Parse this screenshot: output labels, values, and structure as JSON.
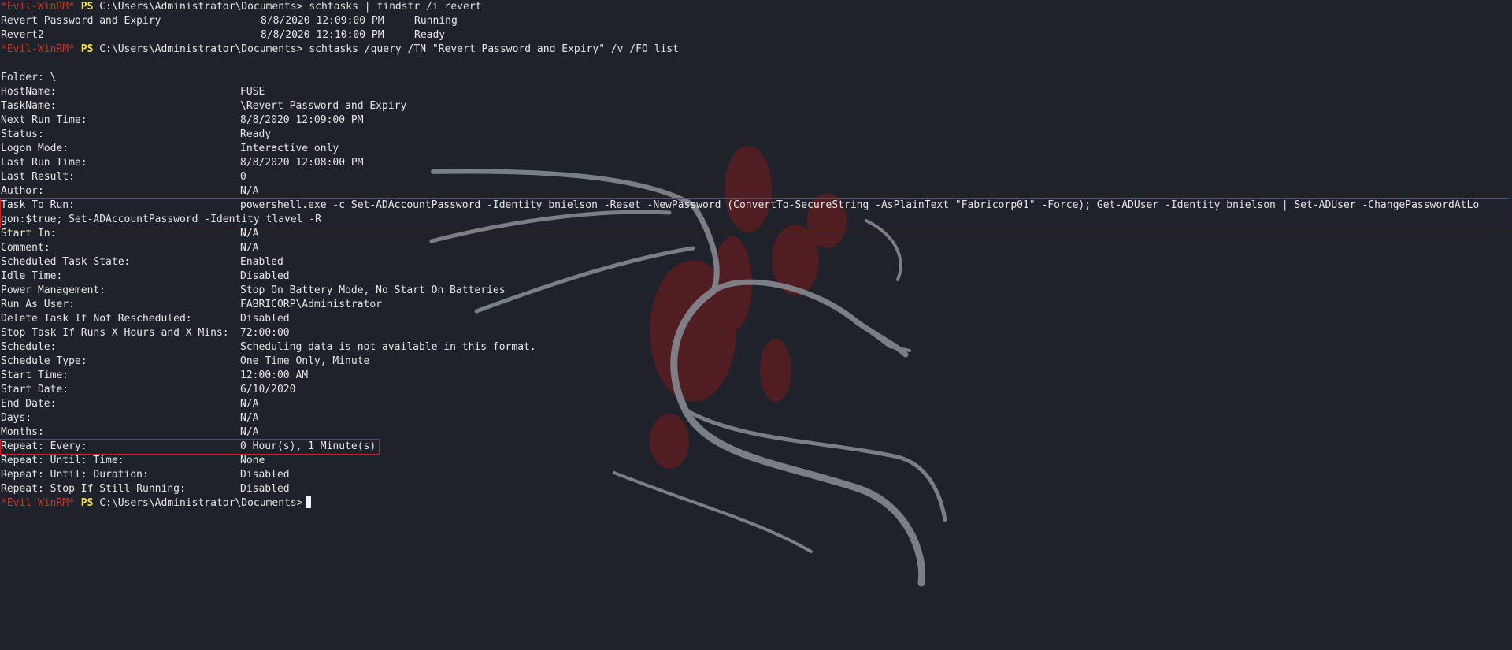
{
  "prompt": {
    "evil_label": "*Evil-WinRM*",
    "ps_label": "PS",
    "path": "C:\\Users\\Administrator\\Documents>"
  },
  "commands": {
    "cmd1": "schtasks | findstr /i revert",
    "cmd2": "schtasks /query /TN \"Revert Password and Expiry\" /v /FO list"
  },
  "findstr_results": [
    {
      "name": "Revert Password and Expiry",
      "time": "8/8/2020 12:09:00 PM",
      "status": "Running"
    },
    {
      "name": "Revert2",
      "time": "8/8/2020 12:10:00 PM",
      "status": "Ready"
    }
  ],
  "folder_line": "Folder: \\",
  "task_fields": [
    {
      "label": "HostName:",
      "value": "FUSE"
    },
    {
      "label": "TaskName:",
      "value": "\\Revert Password and Expiry"
    },
    {
      "label": "Next Run Time:",
      "value": "8/8/2020 12:09:00 PM"
    },
    {
      "label": "Status:",
      "value": "Ready"
    },
    {
      "label": "Logon Mode:",
      "value": "Interactive only"
    },
    {
      "label": "Last Run Time:",
      "value": "8/8/2020 12:08:00 PM"
    },
    {
      "label": "Last Result:",
      "value": "0"
    },
    {
      "label": "Author:",
      "value": "N/A"
    },
    {
      "label": "Task To Run:",
      "value": "powershell.exe -c Set-ADAccountPassword -Identity bnielson -Reset -NewPassword (ConvertTo-SecureString -AsPlainText \"Fabricorp01\" -Force); Get-ADUser -Identity bnielson | Set-ADUser -ChangePasswordAtLo"
    },
    {
      "label": "",
      "value": "gon:$true; Set-ADAccountPassword -Identity tlavel -R"
    },
    {
      "label": "Start In:",
      "value": "N/A"
    },
    {
      "label": "Comment:",
      "value": "N/A"
    },
    {
      "label": "Scheduled Task State:",
      "value": "Enabled"
    },
    {
      "label": "Idle Time:",
      "value": "Disabled"
    },
    {
      "label": "Power Management:",
      "value": "Stop On Battery Mode, No Start On Batteries"
    },
    {
      "label": "Run As User:",
      "value": "FABRICORP\\Administrator"
    },
    {
      "label": "Delete Task If Not Rescheduled:",
      "value": "Disabled"
    },
    {
      "label": "Stop Task If Runs X Hours and X Mins:",
      "value": "72:00:00"
    },
    {
      "label": "Schedule:",
      "value": "Scheduling data is not available in this format."
    },
    {
      "label": "Schedule Type:",
      "value": "One Time Only, Minute"
    },
    {
      "label": "Start Time:",
      "value": "12:00:00 AM"
    },
    {
      "label": "Start Date:",
      "value": "6/10/2020"
    },
    {
      "label": "End Date:",
      "value": "N/A"
    },
    {
      "label": "Days:",
      "value": "N/A"
    },
    {
      "label": "Months:",
      "value": "N/A"
    },
    {
      "label": "Repeat: Every:",
      "value": "0 Hour(s), 1 Minute(s)"
    },
    {
      "label": "Repeat: Until: Time:",
      "value": "None"
    },
    {
      "label": "Repeat: Until: Duration:",
      "value": "Disabled"
    },
    {
      "label": "Repeat: Stop If Still Running:",
      "value": "Disabled"
    }
  ],
  "colors": {
    "background": "#1e222a",
    "text": "#e6e6e6",
    "prompt_red": "#c0392b",
    "prompt_yellow": "#f1e05a",
    "highlight": "#d01f24"
  }
}
